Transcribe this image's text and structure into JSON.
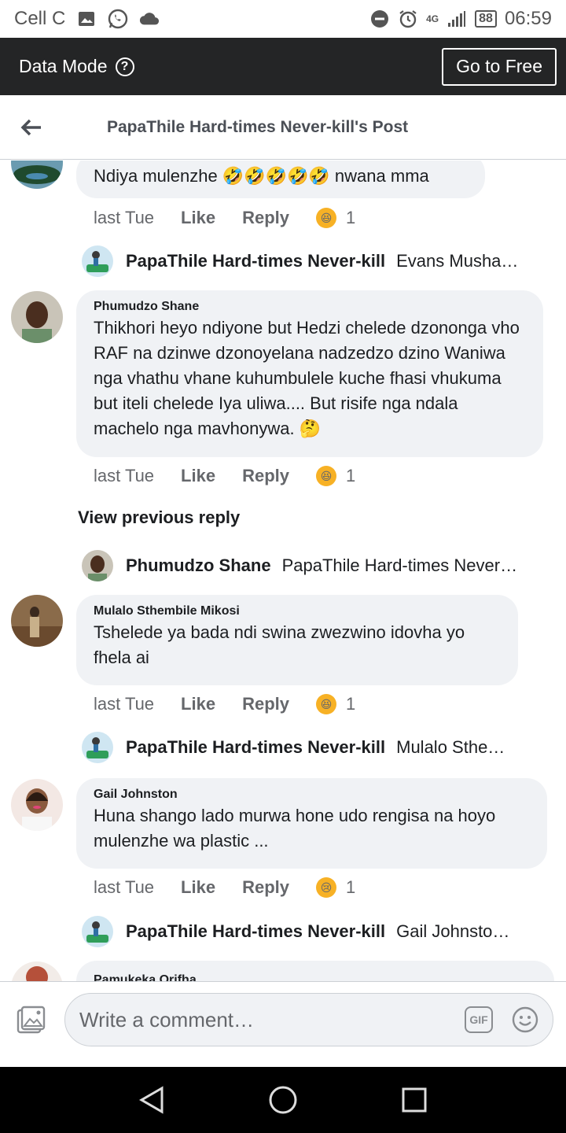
{
  "status_bar": {
    "carrier": "Cell C",
    "network": "4G",
    "battery": "88",
    "time": "06:59"
  },
  "data_mode_bar": {
    "label": "Data Mode",
    "help_glyph": "?",
    "go_free_label": "Go to Free"
  },
  "header": {
    "title": "PapaThile Hard-times Never-kill's Post"
  },
  "comments": [
    {
      "text": "Ndiya mulenzhe 🤣🤣🤣🤣🤣 nwana mma",
      "time": "last Tue",
      "like": "Like",
      "reply": "Reply",
      "reaction": "😆",
      "count": "1",
      "reply_preview": {
        "name": "PapaThile Hard-times Never-kill",
        "text": "Evans Musha…"
      }
    },
    {
      "author": "Phumudzo Shane",
      "text": "Thikhori heyo ndiyone but Hedzi chelede dzononga vho RAF na dzinwe dzonoyelana nadzedzo dzino Waniwa nga vhathu vhane kuhumbulele kuche fhasi vhukuma but iteli chelede Iya uliwa.... But risife nga ndala machelo nga mavhonywa. 🤔",
      "time": "last Tue",
      "like": "Like",
      "reply": "Reply",
      "reaction": "😆",
      "count": "1",
      "view_previous": "View previous reply",
      "reply_preview": {
        "name": "Phumudzo Shane",
        "text": "PapaThile Hard-times Never…"
      }
    },
    {
      "author": "Mulalo Sthembile Mikosi",
      "text": "Tshelede ya bada ndi swina zwezwino idovha yo fhela ai",
      "time": "last Tue",
      "like": "Like",
      "reply": "Reply",
      "reaction": "😆",
      "count": "1",
      "reply_preview": {
        "name": "PapaThile Hard-times Never-kill",
        "text": "Mulalo Sthe…"
      }
    },
    {
      "author": "Gail Johnston",
      "text": "Huna shango lado murwa hone udo rengisa na hoyo mulenzhe wa plastic ...",
      "time": "last Tue",
      "like": "Like",
      "reply": "Reply",
      "reaction": "😢",
      "count": "1",
      "reply_preview": {
        "name": "PapaThile Hard-times Never-kill",
        "text": "Gail Johnsto…"
      }
    },
    {
      "author": "Pamukeka Orifha"
    }
  ],
  "composer": {
    "placeholder": "Write a comment…",
    "gif_label": "GIF"
  },
  "colors": {
    "dark_bar": "#242526",
    "bubble": "#f0f2f5",
    "muted_text": "#65676b"
  }
}
